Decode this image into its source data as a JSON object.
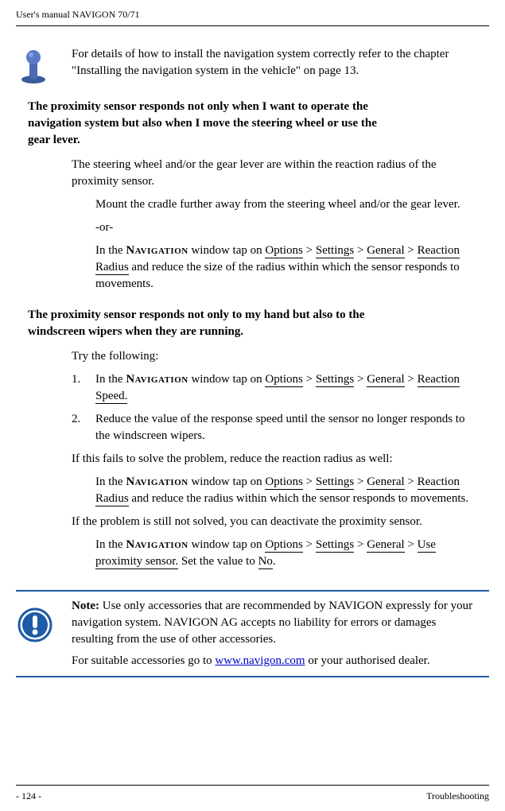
{
  "header": {
    "title": "User's manual NAVIGON 70/71"
  },
  "callout1": {
    "text": "For details of how to install the navigation system correctly refer to the chapter \"Installing the navigation system in the vehicle\" on page 13."
  },
  "section1": {
    "title_l1": "The proximity sensor responds not only when I want to operate the",
    "title_l2": "navigation system but also when I move the steering wheel or use the",
    "title_l3": "gear lever.",
    "p1": "The steering wheel and/or the gear lever are within the reaction radius of the proximity sensor.",
    "p2": "Mount the cradle further away from the steering wheel and/or the gear lever.",
    "or": "-or-",
    "p3_pre": "In the ",
    "nav": "Navigation",
    "p3_mid": " window tap on ",
    "path1": "Options",
    "gt": " > ",
    "path2": "Settings",
    "path3": "General",
    "path4": "Reaction Radius",
    "p3_post": " and reduce the size of the radius within which the sensor responds to movements."
  },
  "section2": {
    "title_l1": "The proximity sensor responds not only to my hand but also to the",
    "title_l2": "windscreen wipers when they are running.",
    "p1": "Try the following:",
    "li1_pre": "In the ",
    "nav": "Navigation",
    "li1_mid": " window tap on ",
    "path1": "Options",
    "gt": " > ",
    "path2": "Settings",
    "path3": "General",
    "path4": "Reaction Speed.",
    "li2": "Reduce the value of the response speed until the sensor no longer responds to the windscreen wipers.",
    "p2": "If this fails to solve the problem, reduce the reaction radius as well:",
    "p3_pre": "In the ",
    "p3_mid": " window tap on ",
    "path5": "Reaction Radius",
    "p3_post": " and reduce the radius within which the sensor responds to movements.",
    "p4": "If the problem is still not solved, you can deactivate the proximity sensor.",
    "p5_pre": "In the ",
    "p5_mid": " window tap on ",
    "path6": "Use proximity sensor.",
    "p5_post": " Set the value to ",
    "no_val": "No",
    "period": "."
  },
  "note": {
    "label": "Note:",
    "p1": " Use only accessories that are recommended by NAVIGON expressly for your navigation system. NAVIGON AG accepts no liability for errors or damages resulting from the use of other accessories.",
    "p2_pre": "For suitable accessories go to ",
    "link": "www.navigon.com",
    "p2_post": " or your authorised dealer."
  },
  "footer": {
    "page": "- 124 -",
    "section": "Troubleshooting"
  }
}
